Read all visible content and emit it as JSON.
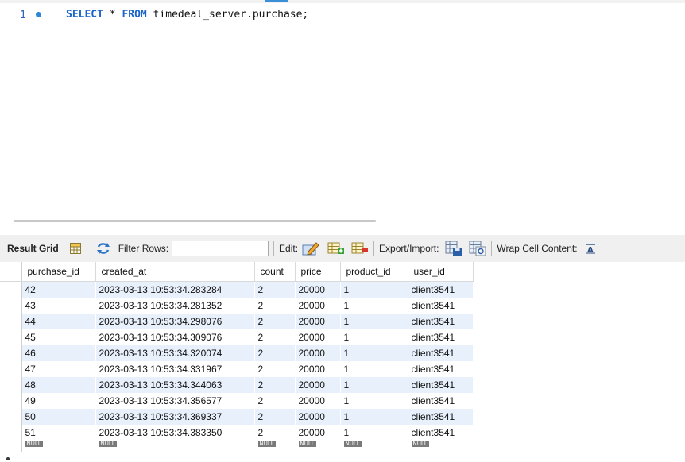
{
  "editor": {
    "line_number": "1",
    "query": {
      "kw_select": "SELECT",
      "star": " * ",
      "kw_from": "FROM",
      "rest": " timedeal_server.purchase;"
    }
  },
  "toolbar": {
    "result_grid": "Result Grid",
    "filter_rows": "Filter Rows:",
    "filter_value": "",
    "edit": "Edit:",
    "export_import": "Export/Import:",
    "wrap_cell": "Wrap Cell Content:"
  },
  "grid": {
    "columns": [
      "purchase_id",
      "created_at",
      "count",
      "price",
      "product_id",
      "user_id"
    ],
    "rows": [
      [
        "42",
        "2023-03-13 10:53:34.283284",
        "2",
        "20000",
        "1",
        "client3541"
      ],
      [
        "43",
        "2023-03-13 10:53:34.281352",
        "2",
        "20000",
        "1",
        "client3541"
      ],
      [
        "44",
        "2023-03-13 10:53:34.298076",
        "2",
        "20000",
        "1",
        "client3541"
      ],
      [
        "45",
        "2023-03-13 10:53:34.309076",
        "2",
        "20000",
        "1",
        "client3541"
      ],
      [
        "46",
        "2023-03-13 10:53:34.320074",
        "2",
        "20000",
        "1",
        "client3541"
      ],
      [
        "47",
        "2023-03-13 10:53:34.331967",
        "2",
        "20000",
        "1",
        "client3541"
      ],
      [
        "48",
        "2023-03-13 10:53:34.344063",
        "2",
        "20000",
        "1",
        "client3541"
      ],
      [
        "49",
        "2023-03-13 10:53:34.356577",
        "2",
        "20000",
        "1",
        "client3541"
      ],
      [
        "50",
        "2023-03-13 10:53:34.369337",
        "2",
        "20000",
        "1",
        "client3541"
      ],
      [
        "51",
        "2023-03-13 10:53:34.383350",
        "2",
        "20000",
        "1",
        "client3541"
      ]
    ],
    "null_label": "NULL"
  },
  "colors": {
    "keyword": "#1a63c9",
    "row_stripe": "#e8f0fb",
    "null_badge": "#7a7a7a"
  }
}
